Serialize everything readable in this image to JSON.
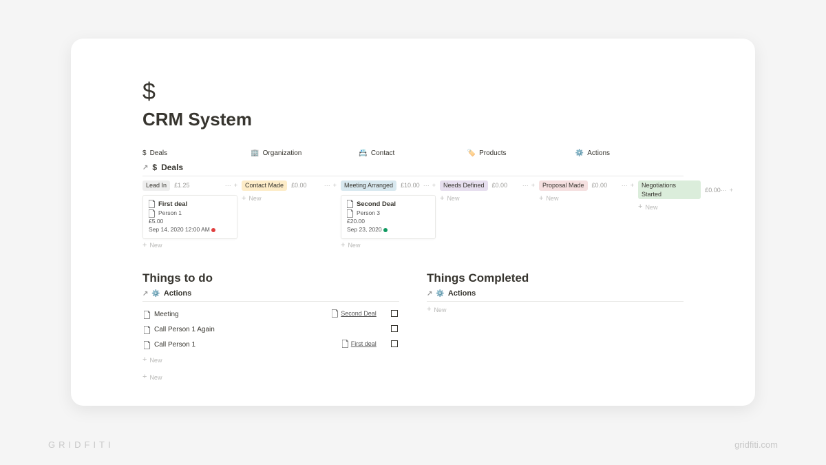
{
  "page": {
    "icon": "$",
    "title": "CRM System"
  },
  "nav": {
    "items": [
      {
        "icon": "$",
        "label": "Deals"
      },
      {
        "icon": "🏢",
        "label": "Organization"
      },
      {
        "icon": "📇",
        "label": "Contact"
      },
      {
        "icon": "🏷️",
        "label": "Products"
      },
      {
        "icon": "⚙️",
        "label": "Actions"
      }
    ]
  },
  "deals": {
    "subhead_icon": "$",
    "subhead_label": "Deals",
    "columns": [
      {
        "name": "Lead In",
        "amount": "£1.25",
        "tag_bg": "#eeeeee",
        "card": {
          "title": "First deal",
          "person": "Person 1",
          "price": "£5.00",
          "date": "Sep 14, 2020 12:00 AM",
          "dot": "red"
        }
      },
      {
        "name": "Contact Made",
        "amount": "£0.00",
        "tag_bg": "#fdecc8"
      },
      {
        "name": "Meeting Arranged",
        "amount": "£10.00",
        "tag_bg": "#d8e8ef",
        "card": {
          "title": "Second Deal",
          "person": "Person 3",
          "price": "£20.00",
          "date": "Sep 23, 2020",
          "dot": "green"
        }
      },
      {
        "name": "Needs Defined",
        "amount": "£0.00",
        "tag_bg": "#e6deee"
      },
      {
        "name": "Proposal Made",
        "amount": "£0.00",
        "tag_bg": "#f5e0e0"
      },
      {
        "name": "Negotiations Started",
        "amount": "£0.00",
        "tag_bg": "#dbeddb"
      }
    ],
    "new_label": "New",
    "more": "···",
    "plus": "+"
  },
  "todo": {
    "heading": "Things to do",
    "sub_icon": "⚙️",
    "sub_label": "Actions",
    "items": [
      {
        "name": "Meeting",
        "deal": "Second Deal"
      },
      {
        "name": "Call Person 1 Again",
        "deal": ""
      },
      {
        "name": "Call Person 1",
        "deal": "First deal"
      }
    ],
    "new_label": "New"
  },
  "done": {
    "heading": "Things Completed",
    "sub_icon": "⚙️",
    "sub_label": "Actions",
    "new_label": "New"
  },
  "watermark": {
    "left": "GRIDFITI",
    "right": "gridfiti.com"
  },
  "colors": {
    "red_gear": "#e03e3e"
  }
}
